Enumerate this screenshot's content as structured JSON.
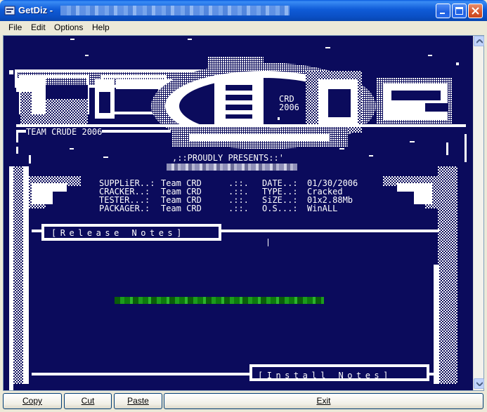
{
  "window": {
    "title": "GetDiz -",
    "icon": "getdiz-app-icon",
    "controls": [
      "minimize-icon",
      "maximize-icon",
      "close-icon"
    ]
  },
  "menu": {
    "items": [
      {
        "label": "File",
        "accel": "F"
      },
      {
        "label": "Edit",
        "accel": "E"
      },
      {
        "label": "Options",
        "accel": "O"
      },
      {
        "label": "Help",
        "accel": "H"
      }
    ]
  },
  "nfo": {
    "logo_badge_line1": "CRD",
    "logo_badge_line2": "2006",
    "team_line": "TEAM CRUDE 2006",
    "presents": ",::PROUDLY PRESENTS::'",
    "info_rows": [
      {
        "left_label": "SUPPLiER..:",
        "left_value": "Team CRD",
        "sep": ".::.",
        "right_label": "DATE..:",
        "right_value": "01/30/2006"
      },
      {
        "left_label": "CRACKER..:",
        "left_value": "Team CRD",
        "sep": ".::.",
        "right_label": "TYPE..:",
        "right_value": "Cracked"
      },
      {
        "left_label": "TESTER...:",
        "left_value": "Team CRD",
        "sep": ".::.",
        "right_label": "SiZE..:",
        "right_value": "01x2.88Mb"
      },
      {
        "left_label": "PACKAGER.:",
        "left_value": "Team CRD",
        "sep": ".::.",
        "right_label": "O.S...:",
        "right_value": "WinALL"
      }
    ],
    "release_notes_header": "[Release Notes]",
    "install_notes_header": "[Install Notes]",
    "colors": {
      "background": "#0b0b5c",
      "text": "#ffffff"
    }
  },
  "buttons": {
    "copy": {
      "label": "Copy",
      "accel": "C"
    },
    "cut": {
      "label": "Cut",
      "accel": "u"
    },
    "paste": {
      "label": "Paste",
      "accel": "P"
    },
    "exit": {
      "label": "Exit",
      "accel": "x"
    }
  }
}
